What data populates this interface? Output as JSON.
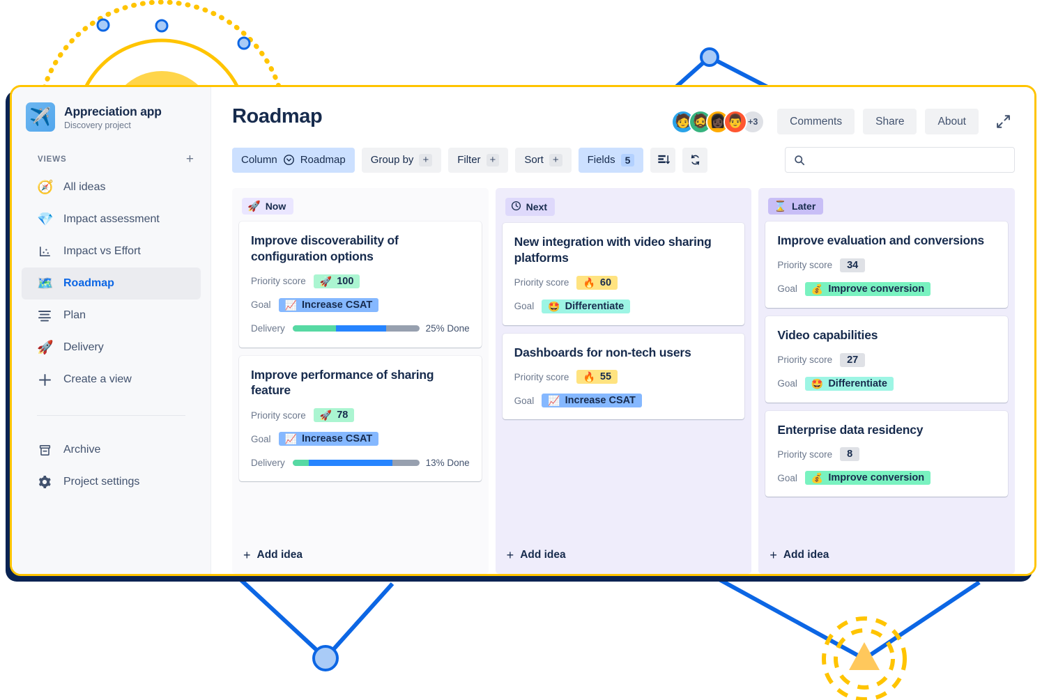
{
  "sidebar": {
    "project": {
      "name": "Appreciation app",
      "subtitle": "Discovery project",
      "avatar_icon": "airplane-icon"
    },
    "views_label": "VIEWS",
    "add_view_glyph": "+",
    "items": [
      {
        "label": "All ideas",
        "icon": "compass-icon",
        "glyph": "🧭",
        "active": false
      },
      {
        "label": "Impact assessment",
        "icon": "gem-icon",
        "glyph": "💎",
        "active": false
      },
      {
        "label": "Impact vs Effort",
        "icon": "scatter-chart-icon",
        "glyph": "",
        "active": false
      },
      {
        "label": "Roadmap",
        "icon": "map-icon",
        "glyph": "🗺️",
        "active": true
      },
      {
        "label": "Plan",
        "icon": "list-lines-icon",
        "glyph": "",
        "active": false
      },
      {
        "label": "Delivery",
        "icon": "rocket-icon",
        "glyph": "🚀",
        "active": false
      },
      {
        "label": "Create a view",
        "icon": "plus-icon",
        "glyph": "",
        "active": false
      }
    ],
    "footer_items": [
      {
        "label": "Archive",
        "icon": "archive-box-icon"
      },
      {
        "label": "Project settings",
        "icon": "gear-icon"
      }
    ]
  },
  "header": {
    "title": "Roadmap",
    "avatar_overflow": "+3",
    "buttons": [
      {
        "label": "Comments",
        "name": "comments-button"
      },
      {
        "label": "Share",
        "name": "share-button"
      },
      {
        "label": "About",
        "name": "about-button"
      }
    ],
    "expand_icon": "expand-diagonal-icon"
  },
  "toolbar": {
    "column": {
      "label": "Column",
      "value": "Roadmap",
      "icon": "chevron-circle-down-icon"
    },
    "group_by": {
      "label": "Group by",
      "add": "+"
    },
    "filter": {
      "label": "Filter",
      "add": "+"
    },
    "sort": {
      "label": "Sort",
      "add": "+"
    },
    "fields": {
      "label": "Fields",
      "count": "5"
    },
    "layout_icon": "card-layout-icon",
    "refresh_icon": "sync-icon",
    "search": {
      "placeholder": "",
      "value": "",
      "icon": "search-icon"
    }
  },
  "board": {
    "add_idea_label": "Add idea",
    "add_idea_glyph": "+",
    "columns": [
      {
        "name": "Now",
        "badge_glyph": "🚀",
        "badge_icon": "rocket-icon",
        "badge_bg": "#EAE6FF",
        "col_bg": "#FAFAFC",
        "cards": [
          {
            "title": "Improve discoverability of configuration options",
            "priority_label": "Priority score",
            "priority_value": "100",
            "priority_glyph": "🚀",
            "priority_icon": "rocket-icon",
            "priority_bg": "#ABF5D1",
            "goal_label": "Goal",
            "goal_value": "Increase CSAT",
            "goal_glyph": "📈",
            "goal_icon": "chart-increasing-icon",
            "goal_bg": "#85B8FF",
            "delivery_label": "Delivery",
            "delivery_text": "25% Done",
            "delivery_green_pct": 34,
            "delivery_blue_pct": 40
          },
          {
            "title": "Improve performance of sharing feature",
            "priority_label": "Priority score",
            "priority_value": "78",
            "priority_glyph": "🚀",
            "priority_icon": "rocket-icon",
            "priority_bg": "#ABF5D1",
            "goal_label": "Goal",
            "goal_value": "Increase CSAT",
            "goal_glyph": "📈",
            "goal_icon": "chart-increasing-icon",
            "goal_bg": "#85B8FF",
            "delivery_label": "Delivery",
            "delivery_text": "13% Done",
            "delivery_green_pct": 13,
            "delivery_blue_pct": 66
          }
        ]
      },
      {
        "name": "Next",
        "badge_glyph": "🕒",
        "badge_icon": "clock-icon",
        "badge_bg": "#DED9FB",
        "col_bg": "#EFEDFB",
        "cards": [
          {
            "title": "New integration with video sharing platforms",
            "priority_label": "Priority score",
            "priority_value": "60",
            "priority_glyph": "🔥",
            "priority_icon": "fire-icon",
            "priority_bg": "#FFE380",
            "goal_label": "Goal",
            "goal_value": "Differentiate",
            "goal_glyph": "🤩",
            "goal_icon": "star-struck-face-icon",
            "goal_bg": "#9DF5E4",
            "delivery_label": "",
            "delivery_text": "",
            "delivery_green_pct": 0,
            "delivery_blue_pct": 0
          },
          {
            "title": "Dashboards for non-tech users",
            "priority_label": "Priority score",
            "priority_value": "55",
            "priority_glyph": "🔥",
            "priority_icon": "fire-icon",
            "priority_bg": "#FFE380",
            "goal_label": "Goal",
            "goal_value": "Increase CSAT",
            "goal_glyph": "📈",
            "goal_icon": "chart-increasing-icon",
            "goal_bg": "#85B8FF",
            "delivery_label": "",
            "delivery_text": "",
            "delivery_green_pct": 0,
            "delivery_blue_pct": 0
          }
        ]
      },
      {
        "name": "Later",
        "badge_glyph": "⌛",
        "badge_icon": "hourglass-icon",
        "badge_bg": "#C8BEF6",
        "col_bg": "#EFEDFB",
        "cards": [
          {
            "title": "Improve evaluation and conversions",
            "priority_label": "Priority score",
            "priority_value": "34",
            "priority_glyph": "",
            "priority_icon": "",
            "priority_bg": "#DFE1E6",
            "goal_label": "Goal",
            "goal_value": "Improve conversion",
            "goal_glyph": "💰",
            "goal_icon": "money-bag-icon",
            "goal_bg": "#79F2C0",
            "delivery_label": "",
            "delivery_text": "",
            "delivery_green_pct": 0,
            "delivery_blue_pct": 0
          },
          {
            "title": "Video capabilities",
            "priority_label": "Priority score",
            "priority_value": "27",
            "priority_glyph": "",
            "priority_icon": "",
            "priority_bg": "#DFE1E6",
            "goal_label": "Goal",
            "goal_value": "Differentiate",
            "goal_glyph": "🤩",
            "goal_icon": "star-struck-face-icon",
            "goal_bg": "#9DF5E4",
            "delivery_label": "",
            "delivery_text": "",
            "delivery_green_pct": 0,
            "delivery_blue_pct": 0
          },
          {
            "title": "Enterprise data residency",
            "priority_label": "Priority score",
            "priority_value": "8",
            "priority_glyph": "",
            "priority_icon": "",
            "priority_bg": "#DFE1E6",
            "goal_label": "Goal",
            "goal_value": "Improve conversion",
            "goal_glyph": "💰",
            "goal_icon": "money-bag-icon",
            "goal_bg": "#79F2C0",
            "delivery_label": "",
            "delivery_text": "",
            "delivery_green_pct": 0,
            "delivery_blue_pct": 0
          }
        ]
      }
    ]
  },
  "decor": {
    "accent_yellow": "#FFC400",
    "accent_blue": "#0C66E4",
    "node_blue": "#A9CBF7",
    "shadow_navy": "#0A2352"
  }
}
